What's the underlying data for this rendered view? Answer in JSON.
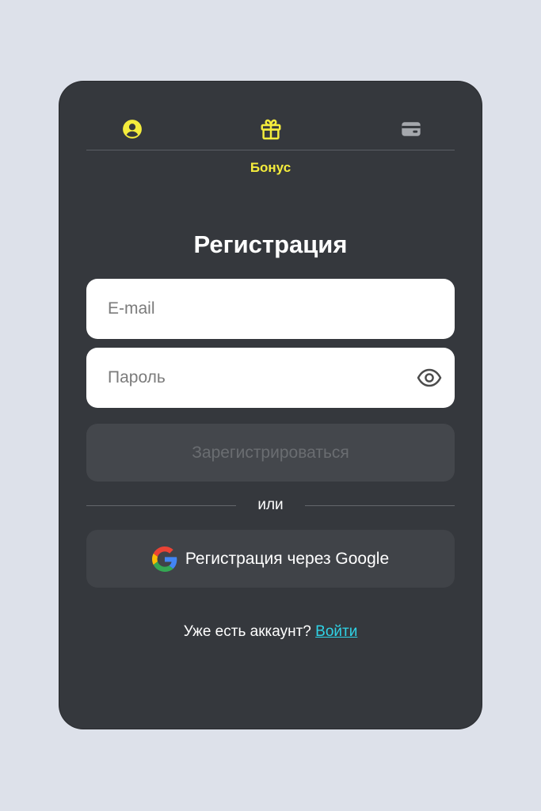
{
  "colors": {
    "page_background": "#dde1ea",
    "card_background": "#35383d",
    "accent_yellow": "#f4ec3c",
    "link_cyan": "#2fd3e6",
    "inactive_icon": "#a5a8ad"
  },
  "tabs": [
    {
      "id": "profile",
      "icon": "user-circle-icon",
      "active": false
    },
    {
      "id": "bonus",
      "icon": "gift-icon",
      "active": true,
      "label": "Бонус"
    },
    {
      "id": "wallet",
      "icon": "wallet-icon",
      "active": false
    }
  ],
  "form": {
    "title": "Регистрация",
    "email": {
      "value": "",
      "placeholder": "E-mail"
    },
    "password": {
      "value": "",
      "placeholder": "Пароль",
      "toggle_icon": "eye-icon"
    },
    "submit_label": "Зарегистрироваться",
    "divider_text": "или",
    "google_label": "Регистрация через Google",
    "google_icon": "google-icon"
  },
  "footer": {
    "question": "Уже есть аккаунт?",
    "login_link": "Войти"
  }
}
